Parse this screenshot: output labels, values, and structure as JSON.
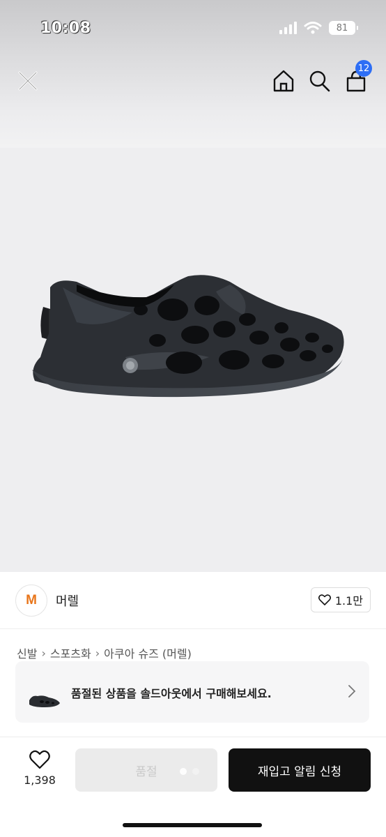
{
  "status_bar": {
    "time": "10:08",
    "battery": "81"
  },
  "header": {
    "cart_count": "12"
  },
  "brand": {
    "logo_letter": "M",
    "name": "머렐",
    "like_count": "1.1만"
  },
  "breadcrumb": {
    "items": [
      "신발",
      "스포츠화",
      "아쿠아 슈즈 (머렐)"
    ]
  },
  "soldout_banner": {
    "text": "품절된 상품을 솔드아웃에서 구매해보세요."
  },
  "bottom_bar": {
    "favorite_count": "1,398",
    "soldout_label": "품절",
    "restock_label": "재입고 알림 신청"
  },
  "colors": {
    "accent_brand": "#e8751a",
    "badge": "#2d6ef5",
    "primary_button": "#111111"
  }
}
